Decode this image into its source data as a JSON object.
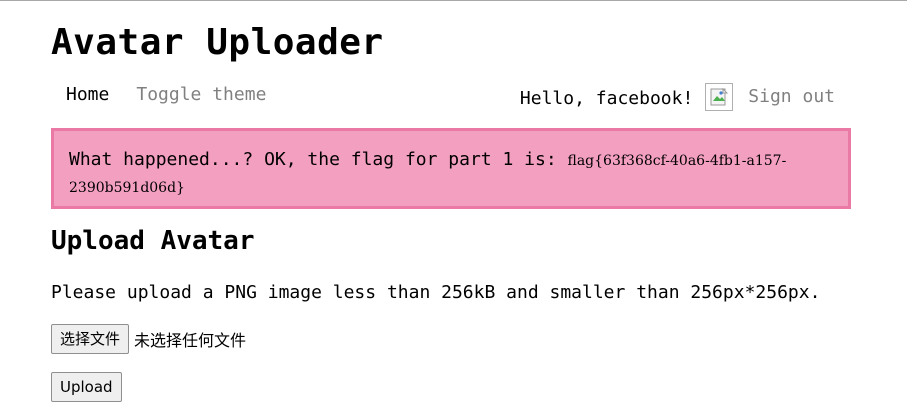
{
  "app": {
    "title": "Avatar Uploader"
  },
  "nav": {
    "home": "Home",
    "toggle_theme": "Toggle theme",
    "greeting": "Hello, facebook!",
    "sign_out": "Sign out"
  },
  "alert": {
    "message": "What happened...? OK, the flag for part 1 is: ",
    "flag": "flag{63f368cf-40a6-4fb1-a157-2390b591d06d}",
    "background_color": "#f39fc0",
    "border_color": "#ea7aa5"
  },
  "upload": {
    "heading": "Upload Avatar",
    "instructions": "Please upload a PNG image less than 256kB and smaller than 256px*256px.",
    "choose_file_label": "选择文件",
    "no_file_text": "未选择任何文件",
    "submit_label": "Upload"
  },
  "icons": {
    "avatar": "broken-image-icon"
  }
}
